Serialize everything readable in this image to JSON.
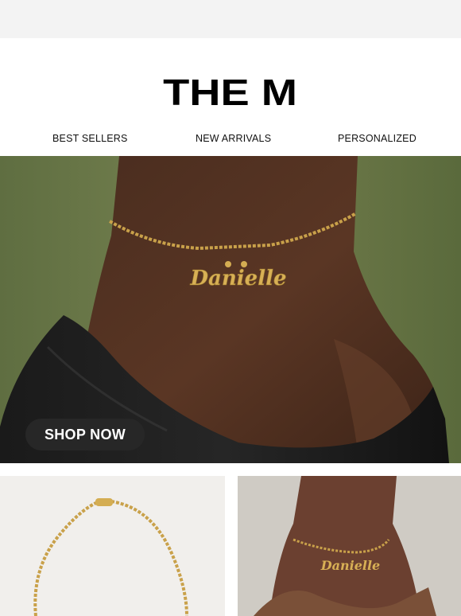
{
  "brand": {
    "logo_text": "THE M"
  },
  "nav": {
    "items": [
      {
        "label": "BEST SELLERS"
      },
      {
        "label": "NEW ARRIVALS"
      },
      {
        "label": "PERSONALIZED"
      }
    ]
  },
  "hero": {
    "pendant_text": "Danielle",
    "cta_label": "SHOP NOW"
  },
  "products": {
    "tile2_pendant_text": "Danielle"
  },
  "colors": {
    "background_outer": "#f3f3f3",
    "background_email": "#ffffff",
    "hero_green": "#6b7747",
    "cta_background": "#2a2a2a",
    "gold": "#c9a14a"
  }
}
